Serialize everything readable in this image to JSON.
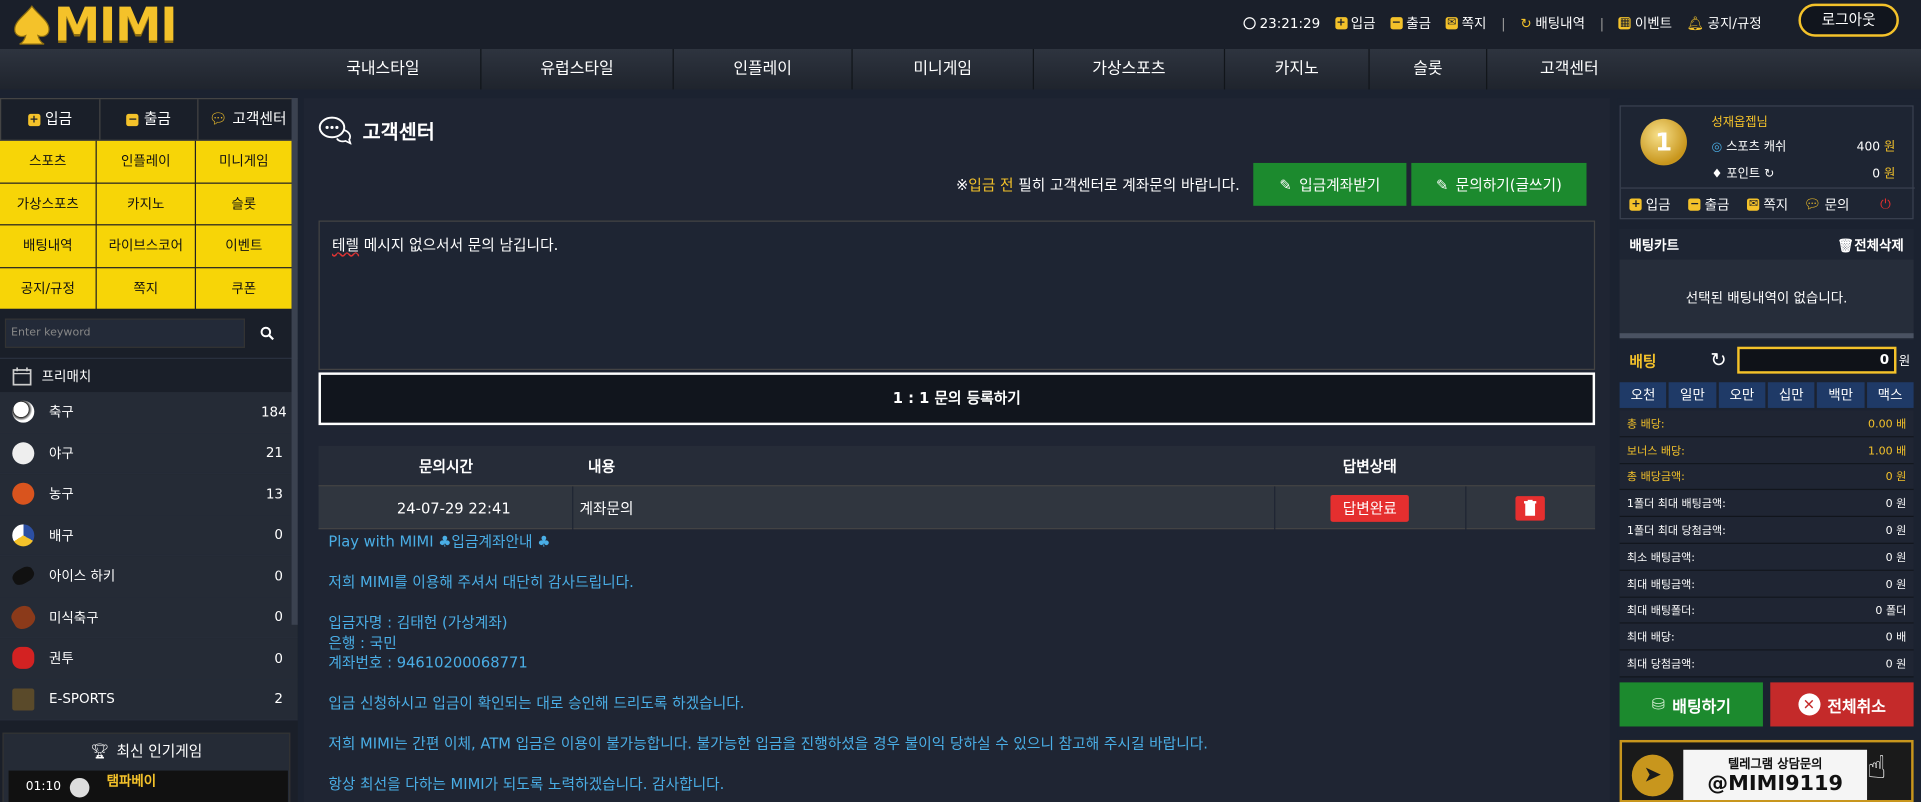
{
  "brand": {
    "logo_text": "MIMI"
  },
  "topbar": {
    "time": "23:21:29",
    "links": [
      "입금",
      "출금",
      "쪽지",
      "배팅내역",
      "이벤트",
      "공지/규정"
    ],
    "logout": "로그아웃"
  },
  "nav": [
    "국내스타일",
    "유럽스타일",
    "인플레이",
    "미니게임",
    "가상스포츠",
    "카지노",
    "슬롯",
    "고객센터"
  ],
  "left": {
    "quick": [
      "입금",
      "출금",
      "고객센터"
    ],
    "grid": [
      "스포츠",
      "인플레이",
      "미니게임",
      "가상스포츠",
      "카지노",
      "슬롯",
      "배팅내역",
      "라이브스코어",
      "이벤트",
      "공지/규정",
      "쪽지",
      "쿠폰"
    ],
    "search_placeholder": "Enter keyword",
    "prematch": "프리매치",
    "sports": [
      {
        "name": "축구",
        "count": "184"
      },
      {
        "name": "야구",
        "count": "21"
      },
      {
        "name": "농구",
        "count": "13"
      },
      {
        "name": "배구",
        "count": "0"
      },
      {
        "name": "아이스 하키",
        "count": "0"
      },
      {
        "name": "미식축구",
        "count": "0"
      },
      {
        "name": "권투",
        "count": "0"
      },
      {
        "name": "E-SPORTS",
        "count": "2"
      }
    ],
    "popular_title": "최신 인기게임",
    "popular_time": "01:10",
    "popular_team": "탬파베이"
  },
  "main": {
    "title": "고객센터",
    "notice_prefix": "※",
    "notice_hi": "입금 전",
    "notice_rest": " 필히 고객센터로 계좌문의 바랍니다.",
    "btn_account": "입금계좌받기",
    "btn_inquiry": "문의하기(글쓰기)",
    "textarea_underlined": "테렐",
    "textarea_rest": " 메시지 없으서서 문의 남깁니다.",
    "register": "1 : 1 문의 등록하기",
    "table_headers": [
      "문의시간",
      "내용",
      "답변상태"
    ],
    "row": {
      "time": "24-07-29 22:41",
      "content": "계좌문의",
      "status": "답변완료"
    },
    "answer_lines": [
      "Play with MIMI ♣입금계좌안내 ♣",
      "",
      "저희 MIMI를 이용해 주셔서 대단히 감사드립니다.",
      "",
      "입금자명 : 김태헌 (가상계좌)",
      "은행 : 국민",
      "계좌번호 : 94610200068771",
      "",
      "입금 신청하시고 입금이 확인되는 대로 승인해 드리도록 하겠습니다.",
      "",
      "저희 MIMI는 간편 이체, ATM 입금은 이용이 불가능합니다. 불가능한 입금을 진행하셨을 경우 불이익 당하실 수 있으니 참고해 주시길 바랍니다.",
      "",
      "항상 최선을 다하는 MIMI가 되도록 노력하겠습니다. 감사합니다."
    ]
  },
  "right": {
    "rank_number": "1",
    "username": "성재옵젭님",
    "cash_label": "스포츠 캐쉬",
    "cash_value": "400",
    "point_label": "포인트",
    "point_value": "0",
    "won": "원",
    "buttons": [
      "입금",
      "출금",
      "쪽지",
      "문의"
    ],
    "cart_title": "배팅카트",
    "cart_clear": "전체삭제",
    "cart_empty": "선택된 배팅내역이 없습니다.",
    "bet_label": "배팅",
    "bet_value": "0",
    "amounts": [
      "오천",
      "일만",
      "오만",
      "십만",
      "백만",
      "맥스"
    ],
    "info": [
      {
        "label": "총 배당:",
        "value": "0.00 배",
        "hi": true
      },
      {
        "label": "보너스 배당:",
        "value": "1.00 배",
        "hi": true
      },
      {
        "label": "총 배당금액:",
        "value": "0 원",
        "hi": true
      },
      {
        "label": "1폴더 최대 배팅금액:",
        "value": "0 원",
        "hi": false
      },
      {
        "label": "1폴더 최대 당첨금액:",
        "value": "0 원",
        "hi": false
      },
      {
        "label": "최소 배팅금액:",
        "value": "0 원",
        "hi": false
      },
      {
        "label": "최대 배팅금액:",
        "value": "0 원",
        "hi": false
      },
      {
        "label": "최대 배팅폴더:",
        "value": "0 폴더",
        "hi": false
      },
      {
        "label": "최대 배당:",
        "value": "0 배",
        "hi": false
      },
      {
        "label": "최대 당첨금액:",
        "value": "0 원",
        "hi": false
      }
    ],
    "bet_btn": "배팅하기",
    "cancel_btn": "전체취소",
    "banner_line1": "텔레그램 상담문의",
    "banner_line2": "@MIMI9119"
  },
  "colors": {
    "accent": "#f4c22a",
    "green": "#1c8a2e",
    "red": "#e52f2f",
    "link": "#4aaee6"
  }
}
